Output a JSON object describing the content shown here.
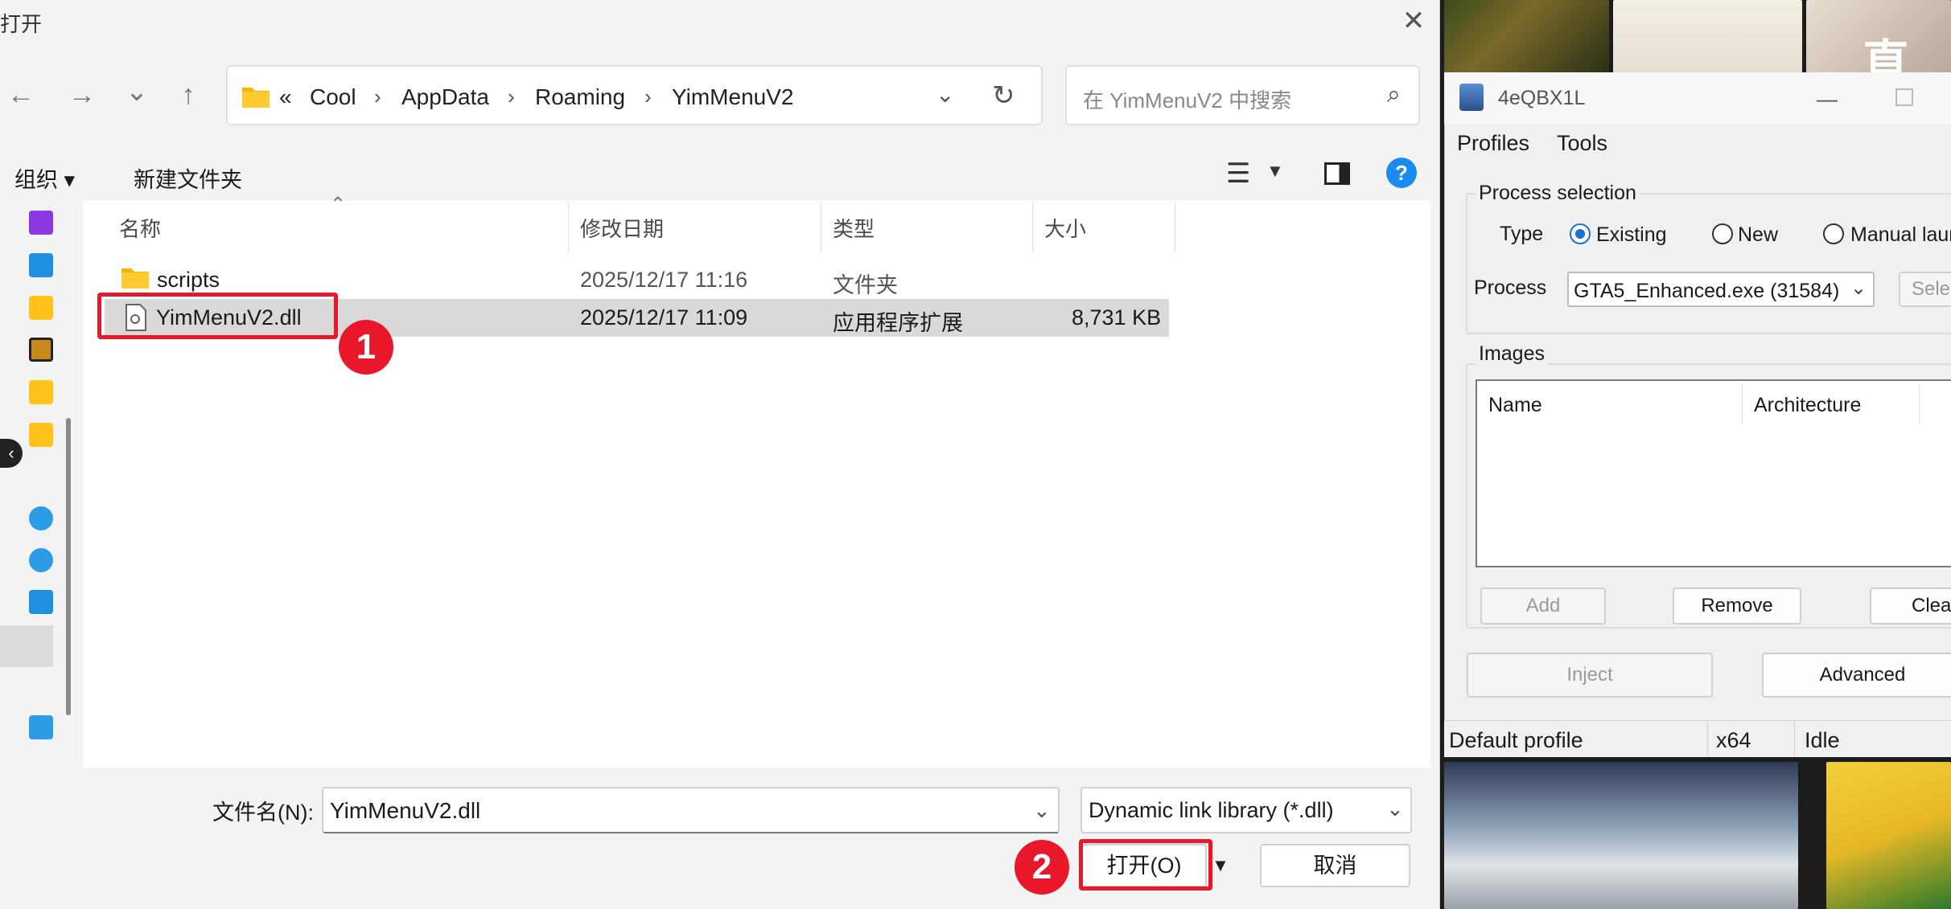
{
  "dialog": {
    "title": "打开",
    "close_icon": "close-icon",
    "nav": {
      "back": "←",
      "forward": "→",
      "recent": "⌄",
      "up": "↑"
    },
    "breadcrumb": {
      "prefix": "«",
      "items": [
        "Cool",
        "AppData",
        "Roaming",
        "YimMenuV2"
      ]
    },
    "search_placeholder": "在 YimMenuV2 中搜索",
    "toolbar": {
      "organize": "组织 ▾",
      "new_folder": "新建文件夹"
    },
    "columns": {
      "name": "名称",
      "date": "修改日期",
      "type": "类型",
      "size": "大小"
    },
    "files": [
      {
        "name": "scripts",
        "date": "2025/12/17 11:16",
        "type": "文件夹",
        "size": "",
        "icon": "folder-icon"
      },
      {
        "name": "YimMenuV2.dll",
        "date": "2025/12/17 11:09",
        "type": "应用程序扩展",
        "size": "8,731 KB",
        "icon": "dll-file-icon",
        "selected": true
      }
    ],
    "filename_label": "文件名(N):",
    "filename_value": "YimMenuV2.dll",
    "filetype": "Dynamic link library (*.dll)",
    "open_button": "打开(O)",
    "cancel_button": "取消"
  },
  "annotations": {
    "step1": "1",
    "step2": "2",
    "highlight_color": "#e8182a"
  },
  "injector": {
    "title": "4eQBX1L",
    "menu": [
      "Profiles",
      "Tools"
    ],
    "process_selection_label": "Process selection",
    "type_label": "Type",
    "type_options": [
      "Existing",
      "New",
      "Manual laun"
    ],
    "selected_type": "Existing",
    "process_label": "Process",
    "process_value": "GTA5_Enhanced.exe (31584)",
    "select_button": "Sele",
    "images_label": "Images",
    "images_columns": [
      "Name",
      "Architecture"
    ],
    "buttons": {
      "add": "Add",
      "remove": "Remove",
      "clear": "Clear",
      "inject": "Inject",
      "advanced": "Advanced"
    },
    "status": {
      "profile": "Default profile",
      "arch": "x64",
      "state": "Idle"
    }
  },
  "background_text": "直奔"
}
